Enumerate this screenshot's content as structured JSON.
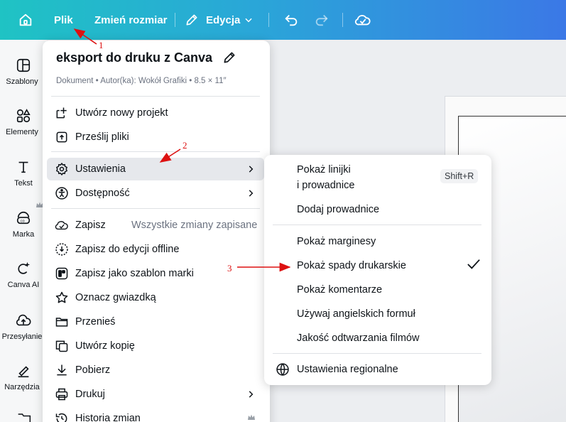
{
  "topbar": {
    "file_label": "Plik",
    "resize_label": "Zmień rozmiar",
    "edit_label": "Edycja"
  },
  "sidebar": {
    "items": [
      {
        "label": "Szablony",
        "icon": "templates-icon"
      },
      {
        "label": "Elementy",
        "icon": "elements-icon"
      },
      {
        "label": "Tekst",
        "icon": "text-icon"
      },
      {
        "label": "Marka",
        "icon": "brand-icon"
      },
      {
        "label": "Canva AI",
        "icon": "canva-ai-icon"
      },
      {
        "label": "Przesyłanie",
        "icon": "upload-icon"
      },
      {
        "label": "Narzędzia",
        "icon": "tools-icon"
      }
    ]
  },
  "file_menu": {
    "title": "eksport do druku z Canva",
    "meta": "Dokument • Autor(ka): Wokół Grafiki • 8.5 × 11″",
    "items": [
      {
        "label": "Utwórz nowy projekt",
        "icon": "new-project-icon"
      },
      {
        "label": "Prześlij pliki",
        "icon": "upload-files-icon"
      },
      {
        "label": "Ustawienia",
        "icon": "settings-icon"
      },
      {
        "label": "Dostępność",
        "icon": "accessibility-icon"
      },
      {
        "label": "Zapisz",
        "icon": "save-icon",
        "status": "Wszystkie zmiany zapisane"
      },
      {
        "label": "Zapisz do edycji offline",
        "icon": "offline-icon"
      },
      {
        "label": "Zapisz jako szablon marki",
        "icon": "brand-template-icon"
      },
      {
        "label": "Oznacz gwiazdką",
        "icon": "star-icon"
      },
      {
        "label": "Przenieś",
        "icon": "folder-icon"
      },
      {
        "label": "Utwórz kopię",
        "icon": "copy-icon"
      },
      {
        "label": "Pobierz",
        "icon": "download-icon"
      },
      {
        "label": "Drukuj",
        "icon": "print-icon"
      },
      {
        "label": "Historia zmian",
        "icon": "history-icon"
      }
    ]
  },
  "settings_submenu": {
    "items": [
      {
        "label_line1": "Pokaż linijki",
        "label_line2": "i prowadnice",
        "shortcut": "Shift+R"
      },
      {
        "label": "Dodaj prowadnice"
      },
      {
        "label": "Pokaż marginesy"
      },
      {
        "label": "Pokaż spady drukarskie",
        "checked": true
      },
      {
        "label": "Pokaż komentarze"
      },
      {
        "label": "Używaj angielskich formuł"
      },
      {
        "label": "Jakość odtwarzania filmów"
      },
      {
        "label": "Ustawienia regionalne",
        "icon": "globe-icon"
      }
    ]
  },
  "annotations": [
    "1",
    "2",
    "3"
  ],
  "colors": {
    "annotation": "#dd1111",
    "topbar_start": "#1fc3c4",
    "topbar_end": "#3b78e6"
  }
}
